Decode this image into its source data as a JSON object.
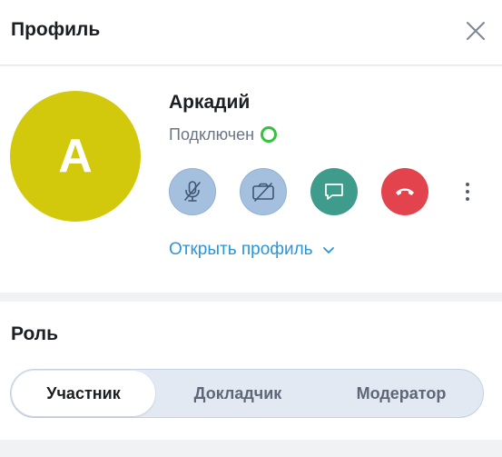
{
  "header": {
    "title": "Профиль",
    "close_icon": "close-icon"
  },
  "user": {
    "avatar_initial": "А",
    "avatar_color": "#d2c90c",
    "name": "Аркадий",
    "status": "Подключен",
    "status_color": "#36c23f"
  },
  "actions": [
    {
      "icon": "microphone-off-icon",
      "color": "#a4c0de"
    },
    {
      "icon": "camera-off-icon",
      "color": "#a4c0de"
    },
    {
      "icon": "chat-icon",
      "color": "#3f9b8b"
    },
    {
      "icon": "hang-up-icon",
      "color": "#e2434c"
    },
    {
      "icon": "more-vertical-icon"
    }
  ],
  "open_profile": {
    "label": "Открыть профиль",
    "icon": "chevron-down-icon",
    "color": "#2b95d9"
  },
  "role": {
    "title": "Роль",
    "options": [
      "Участник",
      "Докладчик",
      "Модератор"
    ],
    "selected": "Участник"
  }
}
